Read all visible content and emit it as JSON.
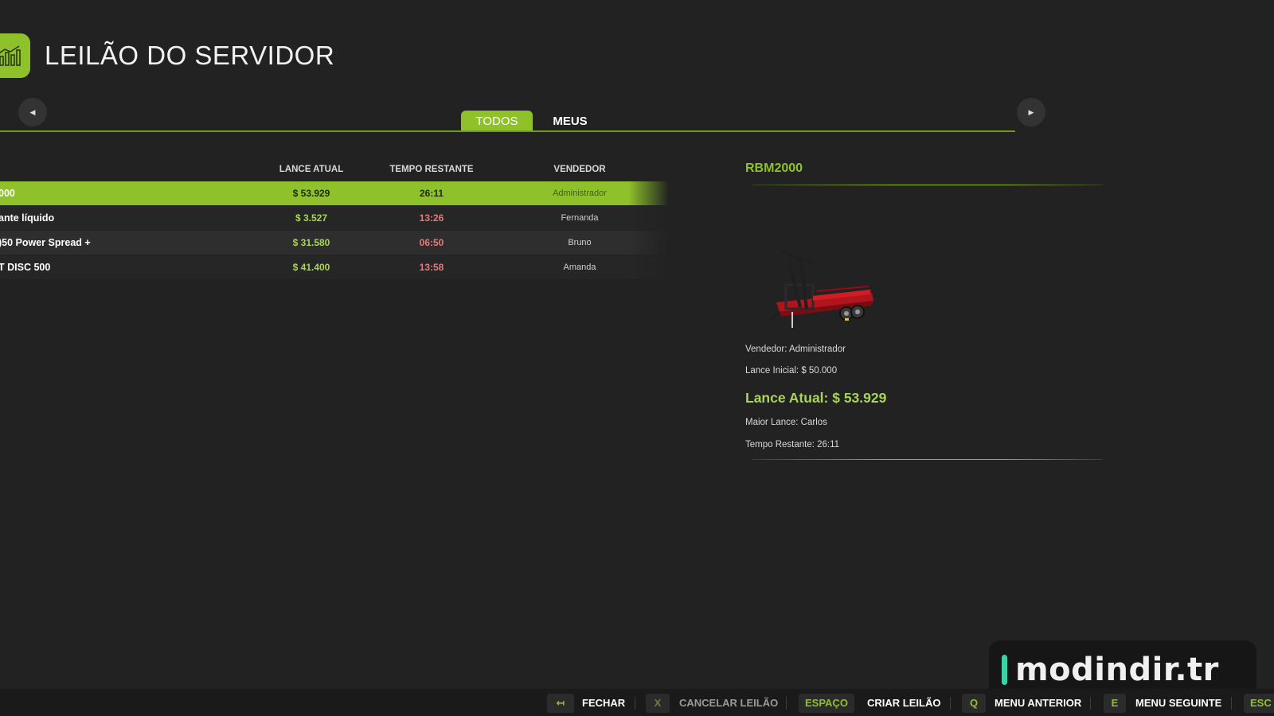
{
  "header": {
    "title": "LEILÃO DO SERVIDOR",
    "icon": "chart-icon"
  },
  "tabs": [
    {
      "label": "TODOS",
      "active": true
    },
    {
      "label": "MEUS",
      "active": false
    }
  ],
  "table": {
    "columns": [
      "LANCE ATUAL",
      "TEMPO RESTANTE",
      "VENDEDOR"
    ],
    "rows": [
      {
        "name": "000",
        "bid": "$ 53.929",
        "time": "26:11",
        "seller": "Administrador"
      },
      {
        "name": "ante líquido",
        "bid": "$ 3.527",
        "time": "13:26",
        "seller": "Fernanda"
      },
      {
        "name": ")50 Power Spread +",
        "bid": "$ 31.580",
        "time": "06:50",
        "seller": "Bruno"
      },
      {
        "name": "T DISC 500",
        "bid": "$ 41.400",
        "time": "13:58",
        "seller": "Amanda"
      }
    ]
  },
  "detail": {
    "title": "RBM2000",
    "seller": "Vendedor: Administrador",
    "starting_bid": "Lance Inicial: $ 50.000",
    "current_bid": "Lance Atual: $ 53.929",
    "highest_bidder": "Maior Lance: Carlos",
    "time_left": "Tempo Restante: 26:11"
  },
  "footer": {
    "actions": [
      {
        "key": "↤",
        "label": "FECHAR",
        "enabled": true
      },
      {
        "key": "X",
        "label": "CANCELAR LEILÃO",
        "enabled": false
      },
      {
        "key": "ESPAÇO",
        "label": "CRIAR LEILÃO",
        "enabled": true
      },
      {
        "key": "Q",
        "label": "MENU ANTERIOR",
        "enabled": true
      },
      {
        "key": "E",
        "label": "MENU SEGUINTE",
        "enabled": true
      },
      {
        "key": "ESC",
        "label": "",
        "enabled": true
      }
    ]
  },
  "watermark": {
    "text": "modindir.tr"
  },
  "colors": {
    "accent": "#8fc12a",
    "background": "#222222",
    "time_warning": "#e47a7a",
    "bid_value": "#a8d45a"
  }
}
